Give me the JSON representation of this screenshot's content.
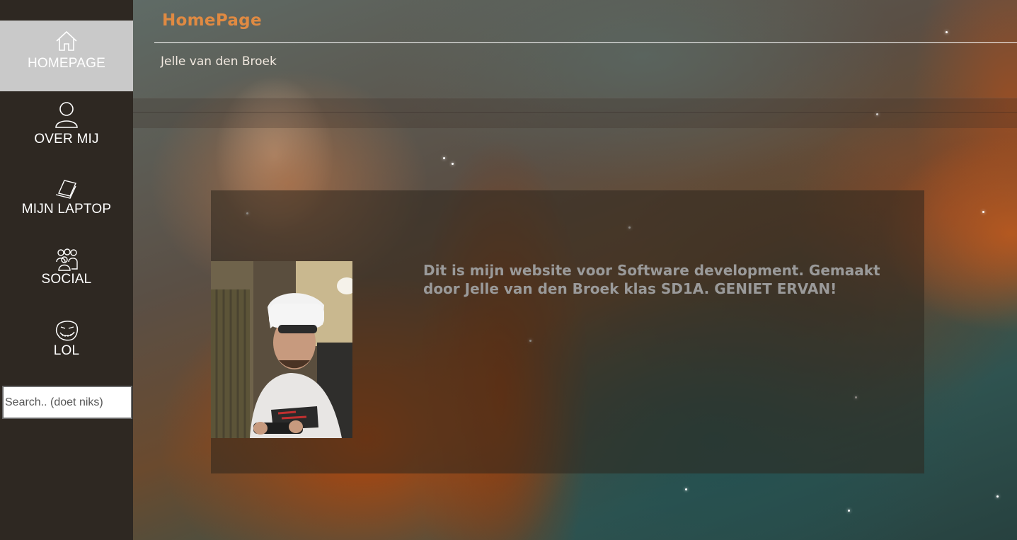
{
  "sidebar": {
    "items": [
      {
        "label": "HOMEPAGE",
        "icon": "home-icon",
        "active": true
      },
      {
        "label": "OVER MIJ",
        "icon": "user-icon",
        "active": false
      },
      {
        "label": "MIJN LAPTOP",
        "icon": "laptop-icon",
        "active": false
      },
      {
        "label": "SOCIAL",
        "icon": "people-group-icon",
        "active": false
      },
      {
        "label": "LOL",
        "icon": "trollface-icon",
        "active": false
      }
    ],
    "search": {
      "placeholder": "Search.. (doet niks)",
      "value": ""
    }
  },
  "header": {
    "title": "HomePage",
    "author": "Jelle van den Broek"
  },
  "main": {
    "intro_text": "Dit is mijn website voor Software development. Gemaakt door Jelle van den Broek klas SD1A. GENIET ERVAN!",
    "photo": "photo of person wearing VR headset holding a controller"
  },
  "colors": {
    "sidebar_bg": "#2e2822",
    "active_item_bg": "#c9c9c9",
    "title_color": "#e08a42",
    "intro_text_color": "#9a9a9a"
  }
}
